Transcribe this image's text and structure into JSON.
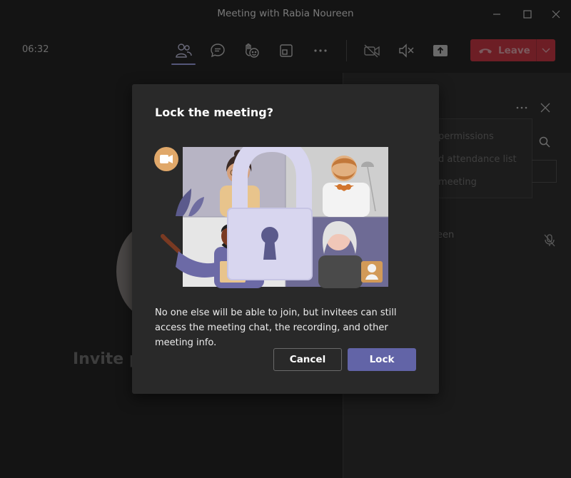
{
  "window": {
    "title": "Meeting with Rabia Noureen"
  },
  "toolbar": {
    "timer": "06:32",
    "leave_label": "Leave"
  },
  "stage": {
    "invite_text": "Invite p"
  },
  "right_panel": {
    "menu_items": [
      "permissions",
      "d attendance list",
      "meeting"
    ],
    "participant_partial": "een"
  },
  "dialog": {
    "title": "Lock the meeting?",
    "body": "No one else will be able to join, but invitees can still access the meeting chat, the recording, and other meeting info.",
    "cancel_label": "Cancel",
    "lock_label": "Lock"
  },
  "colors": {
    "accent": "#6264a7",
    "leave_red": "#6d1e25",
    "dialog_bg": "#292929",
    "app_bg": "#141414"
  },
  "icons": {
    "window_controls": [
      "minimize-icon",
      "maximize-icon",
      "close-icon"
    ],
    "toolbar": [
      "participants-icon",
      "chat-icon",
      "reactions-icon",
      "rooms-icon",
      "more-icon",
      "camera-off-icon",
      "mic-muted-icon",
      "share-icon",
      "phone-icon",
      "chevron-down-icon"
    ],
    "panel": [
      "more-icon",
      "close-icon",
      "search-icon",
      "mic-off-icon"
    ]
  }
}
